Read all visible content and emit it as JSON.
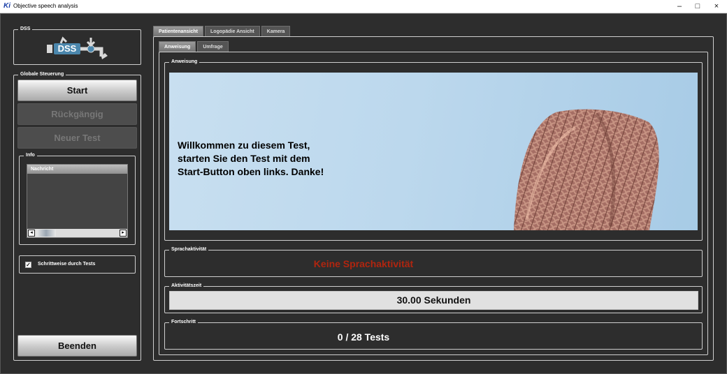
{
  "window": {
    "icon": "Ki",
    "title": "Objective speech analysis",
    "controls": {
      "minimize": "–",
      "maximize": "□",
      "close": "×"
    }
  },
  "left_panel": {
    "dss_group": {
      "legend": "DSS",
      "logo_text": "DSS"
    },
    "global_control": {
      "legend": "Globale Steuerung",
      "buttons": {
        "start": "Start",
        "undo": "Rückgängig",
        "new_test": "Neuer Test",
        "exit": "Beenden"
      }
    },
    "info": {
      "legend": "Info",
      "list_header": "Nachricht",
      "scroll_left": "◂",
      "scroll_right": "▸"
    },
    "stepwise": {
      "checked_mark": "✓",
      "label": "Schrittweise durch Tests"
    }
  },
  "tabs": {
    "main": [
      "Patientenansicht",
      "Logopädie Ansicht",
      "Kamera"
    ],
    "sub": [
      "Anweisung",
      "Umfrage"
    ]
  },
  "patient_view": {
    "instruction": {
      "legend": "Anweisung",
      "message_lines": [
        "Willkommen zu diesem Test,",
        "starten Sie den Test mit dem",
        "Start-Button oben links. Danke!"
      ]
    },
    "speech_activity": {
      "legend": "Sprachaktivität",
      "status": "Keine Sprachaktivität"
    },
    "activity_time": {
      "legend": "Aktivitätszeit",
      "value": "30.00 Sekunden"
    },
    "progress": {
      "legend": "Fortschritt",
      "value": "0 / 28 Tests"
    }
  },
  "colors": {
    "background": "#2d2d2d",
    "accent_red": "#b0250f",
    "title_icon": "#1a3fa8"
  }
}
